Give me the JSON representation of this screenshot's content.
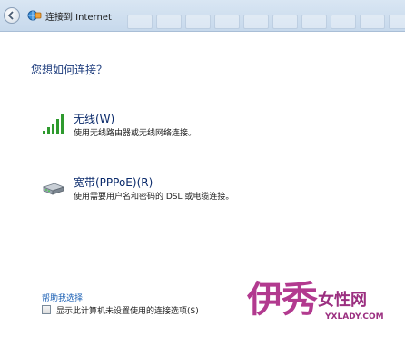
{
  "window": {
    "title": "连接到 Internet"
  },
  "page": {
    "question": "您想如何连接？"
  },
  "options": [
    {
      "title": "无线(W)",
      "description": "使用无线路由器或无线网络连接。",
      "icon": "wireless-signal-icon"
    },
    {
      "title": "宽带(PPPoE)(R)",
      "description": "使用需要用户名和密码的 DSL 或电缆连接。",
      "icon": "broadband-modem-icon"
    }
  ],
  "footer": {
    "checkbox_label": "显示此计算机未设置使用的连接选项(S)",
    "help_link": "帮助我选择"
  },
  "watermark": {
    "brand": "伊秀",
    "subtitle": "女性网",
    "url": "YXLADY.COM"
  },
  "colors": {
    "title_blue": "#1e3d7d",
    "link_blue": "#1a5fb4",
    "signal_green": "#2e9a2e",
    "watermark": "#b23a8f"
  }
}
